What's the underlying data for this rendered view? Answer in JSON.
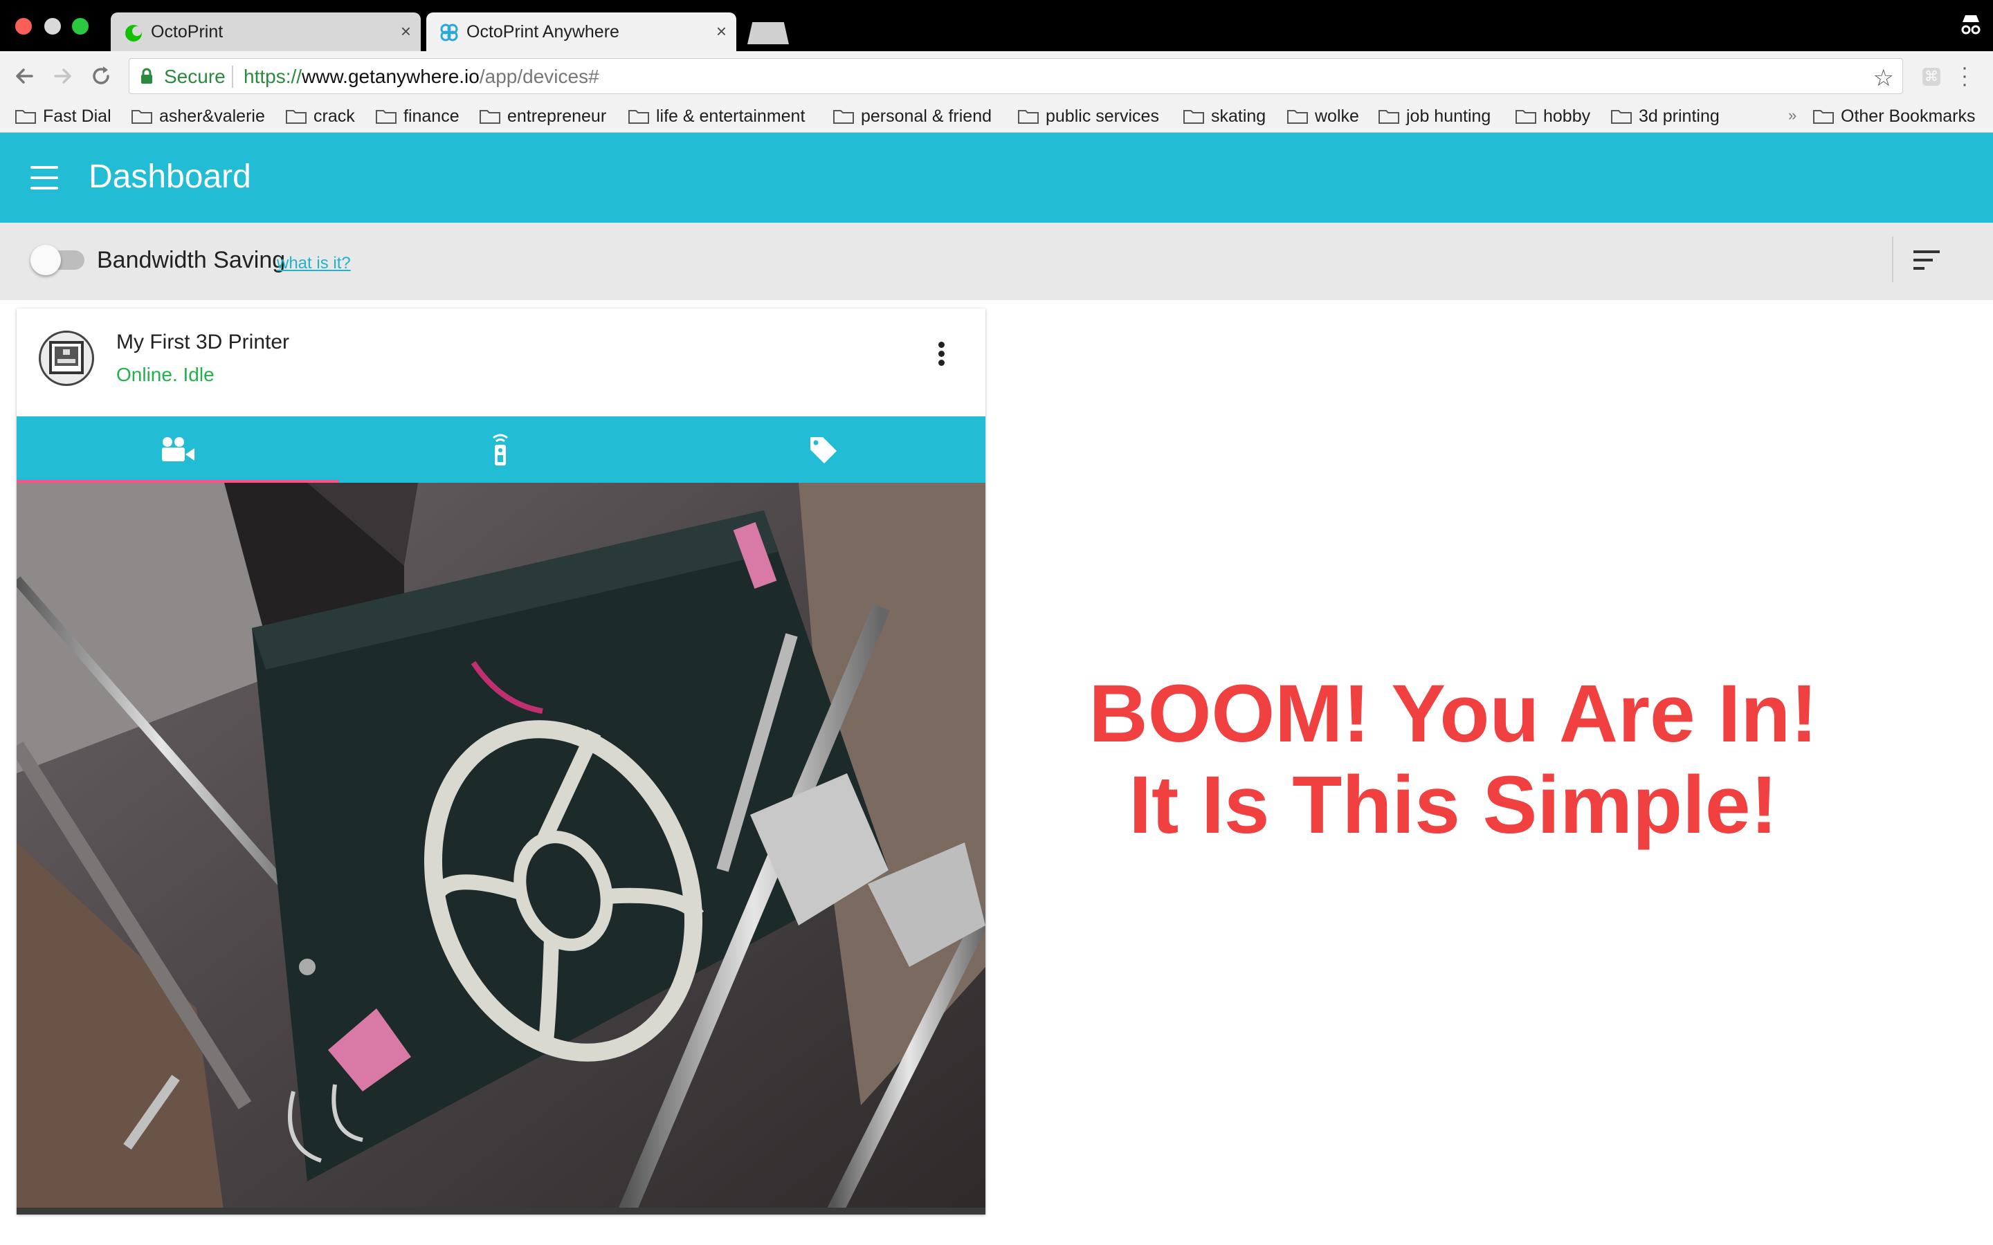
{
  "browser": {
    "tabs": [
      {
        "title": "OctoPrint",
        "icon": "octoprint-icon",
        "active": false
      },
      {
        "title": "OctoPrint Anywhere",
        "icon": "octoprint-anywhere-icon",
        "active": true
      }
    ],
    "address": {
      "secure_label": "Secure",
      "scheme": "https://",
      "host": "www.getanywhere.io",
      "path": "/app/devices#"
    },
    "bookmarks": [
      "Fast Dial",
      "asher&valerie",
      "crack",
      "finance",
      "entrepreneur",
      "life & entertainment",
      "personal & friend",
      "public services",
      "skating",
      "wolke",
      "job hunting",
      "hobby",
      "3d printing"
    ],
    "bookmarks_overflow": "»",
    "other_bookmarks": "Other Bookmarks"
  },
  "app": {
    "title": "Dashboard",
    "accent_color": "#22bcd5",
    "bandwidth": {
      "label": "Bandwidth Saving",
      "link": "what is it?",
      "enabled": false
    },
    "device": {
      "name": "My First 3D Printer",
      "status": "Online. Idle",
      "status_color": "#21b24b",
      "tabs": [
        {
          "icon": "video-camera-icon",
          "selected": true
        },
        {
          "icon": "remote-control-icon",
          "selected": false
        },
        {
          "icon": "tag-icon",
          "selected": false
        }
      ]
    }
  },
  "promo": {
    "line1": "BOOM! You Are In!",
    "line2": "It Is This Simple!",
    "color": "#f04040"
  }
}
